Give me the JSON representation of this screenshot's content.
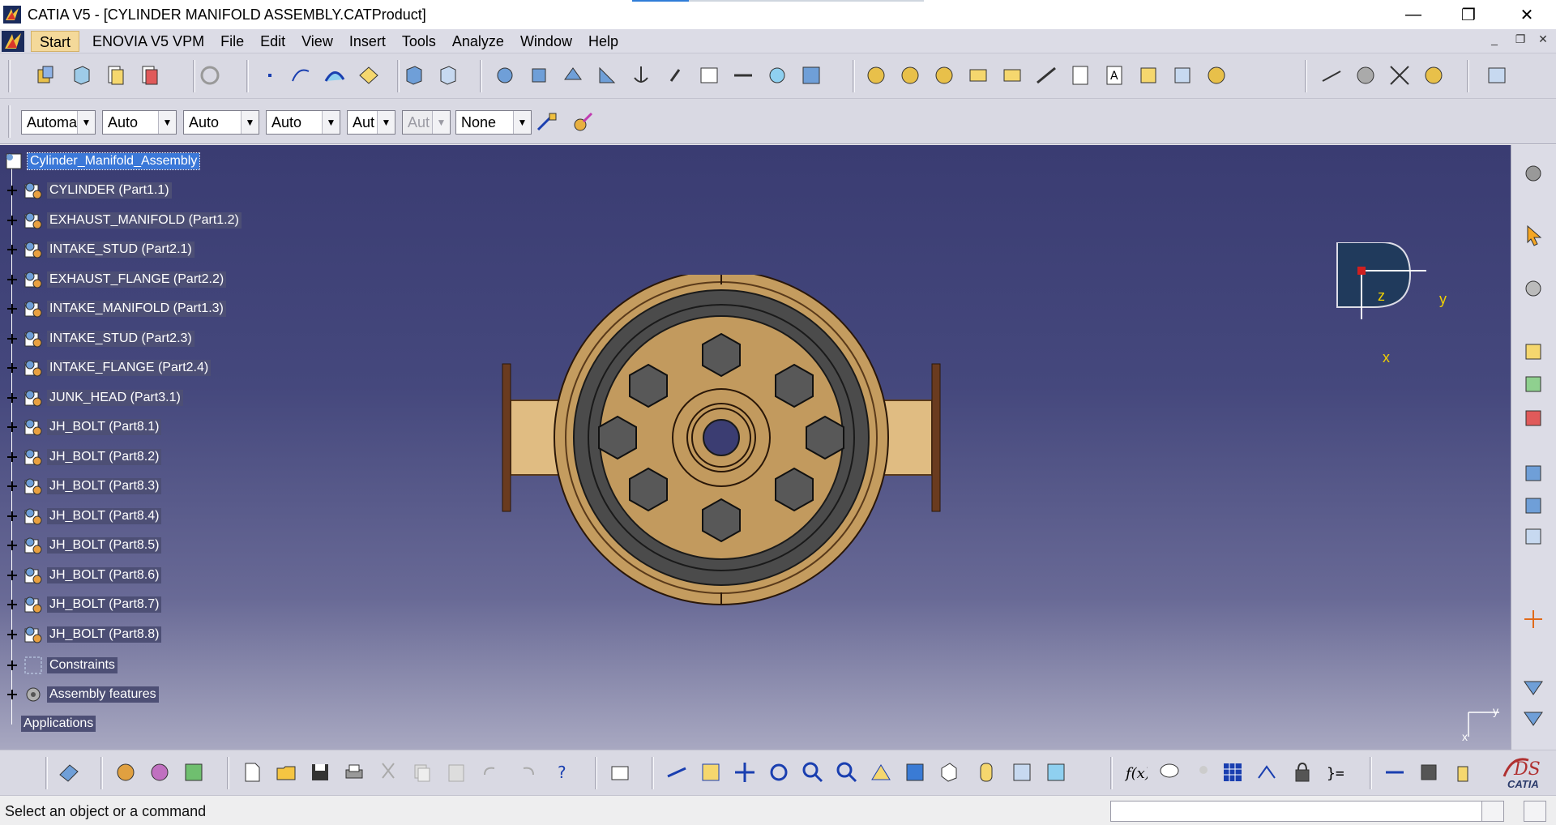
{
  "window": {
    "title": "CATIA V5 - [CYLINDER MANIFOLD ASSEMBLY.CATProduct]",
    "minimize": "—",
    "restore": "❐",
    "close": "✕"
  },
  "menu": {
    "items": [
      {
        "label": "Start",
        "name": "menu-start"
      },
      {
        "label": "ENOVIA V5 VPM",
        "name": "menu-enovia"
      },
      {
        "label": "File",
        "name": "menu-file"
      },
      {
        "label": "Edit",
        "name": "menu-edit"
      },
      {
        "label": "View",
        "name": "menu-view"
      },
      {
        "label": "Insert",
        "name": "menu-insert"
      },
      {
        "label": "Tools",
        "name": "menu-tools"
      },
      {
        "label": "Analyze",
        "name": "menu-analyze"
      },
      {
        "label": "Window",
        "name": "menu-window"
      },
      {
        "label": "Help",
        "name": "menu-help"
      }
    ]
  },
  "properties_toolbar": {
    "combos": [
      {
        "value": "Automa",
        "name": "color-combo"
      },
      {
        "value": "Auto",
        "name": "transparency-combo"
      },
      {
        "value": "Auto",
        "name": "line-thickness-combo"
      },
      {
        "value": "Auto",
        "name": "line-type-combo"
      },
      {
        "value": "Aut",
        "name": "point-type-combo"
      },
      {
        "value": "Aut",
        "name": "layer-auto-combo"
      },
      {
        "value": "None",
        "name": "layer-combo"
      }
    ]
  },
  "tree": {
    "root": "Cylinder_Manifold_Assembly",
    "items": [
      "CYLINDER (Part1.1)",
      "EXHAUST_MANIFOLD (Part1.2)",
      "INTAKE_STUD (Part2.1)",
      "EXHAUST_FLANGE (Part2.2)",
      "INTAKE_MANIFOLD (Part1.3)",
      "INTAKE_STUD (Part2.3)",
      "INTAKE_FLANGE (Part2.4)",
      "JUNK_HEAD (Part3.1)",
      "JH_BOLT (Part8.1)",
      "JH_BOLT (Part8.2)",
      "JH_BOLT (Part8.3)",
      "JH_BOLT (Part8.4)",
      "JH_BOLT (Part8.5)",
      "JH_BOLT (Part8.6)",
      "JH_BOLT (Part8.7)",
      "JH_BOLT (Part8.8)"
    ],
    "constraints": "Constraints",
    "assembly_features": "Assembly features",
    "applications": "Applications"
  },
  "compass": {
    "z": "z",
    "y": "y",
    "x": "x"
  },
  "mini_axis": {
    "y": "y",
    "x": "x"
  },
  "status": {
    "message": "Select an object or a command"
  },
  "catia_logo": "CATIA",
  "colors": {
    "viewport_top": "#3a3c72",
    "viewport_bottom": "#a8a8c1",
    "part_tan": "#c29a5e",
    "bolt_gray": "#585858",
    "selection_blue": "#3b78d8"
  }
}
